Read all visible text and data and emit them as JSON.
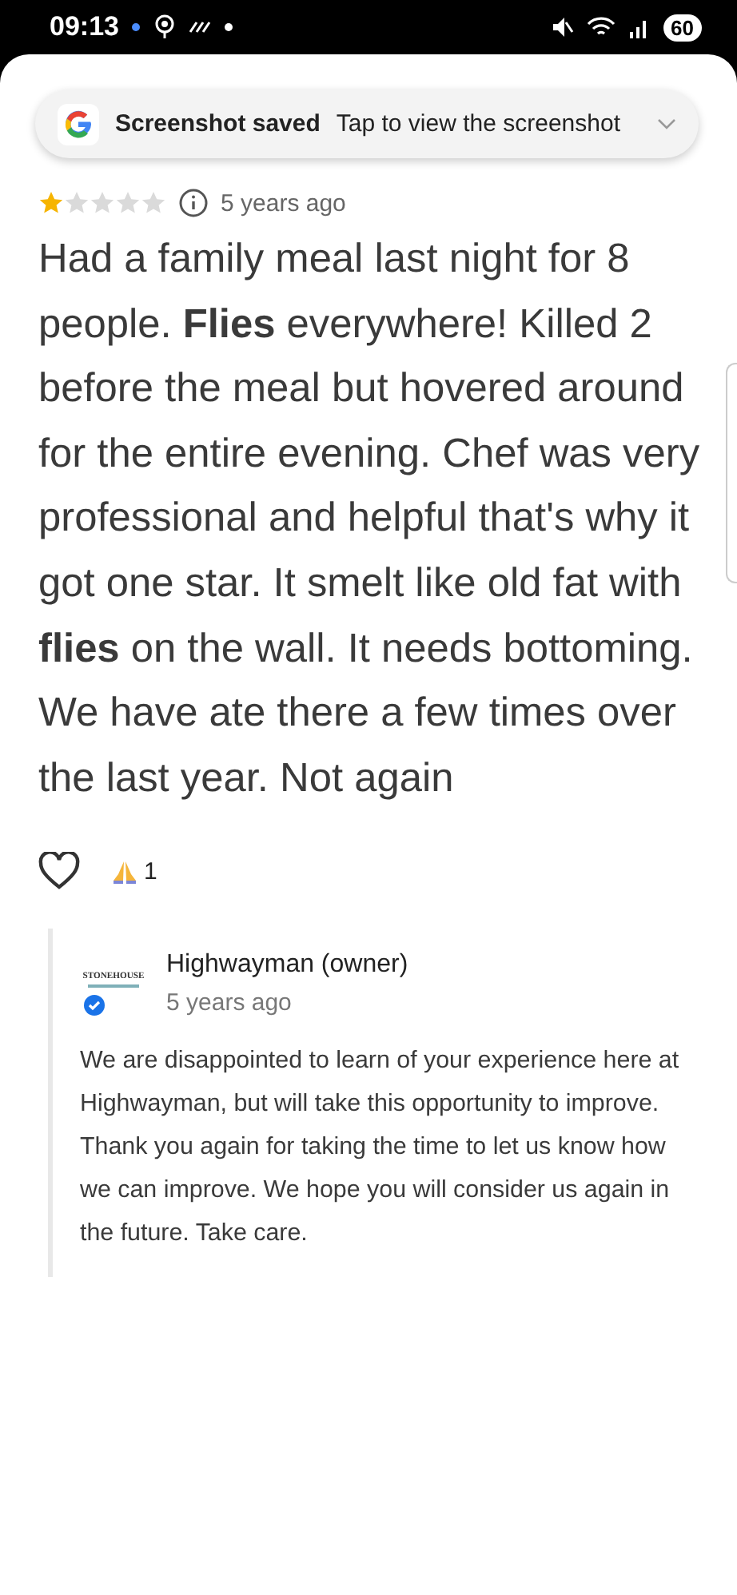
{
  "status_bar": {
    "time": "09:13",
    "battery": "60"
  },
  "toast": {
    "title": "Screenshot saved",
    "message": "Tap to view the screenshot"
  },
  "review": {
    "stars": 1,
    "age": "5 years ago",
    "text": "Had a family meal last night for 8 people. **Flies** everywhere! Killed 2 before the meal but hovered around for the entire evening. Chef was very professional and helpful that's why it got one star. It smelt like old fat with **flies** on the wall. It needs bottoming. We have ate there a few times over the last year. Not again",
    "liked": false,
    "reaction_count": "1"
  },
  "owner_reply": {
    "logo_text": "STONEHOUSE",
    "name": "Highwayman (owner)",
    "verified": true,
    "age": "5 years ago",
    "text": "We are disappointed to learn of your experience here at Highwayman, but will take this opportunity to improve. Thank you again for taking the time to let us know how we can improve. We hope you will consider us again in the future. Take care."
  }
}
